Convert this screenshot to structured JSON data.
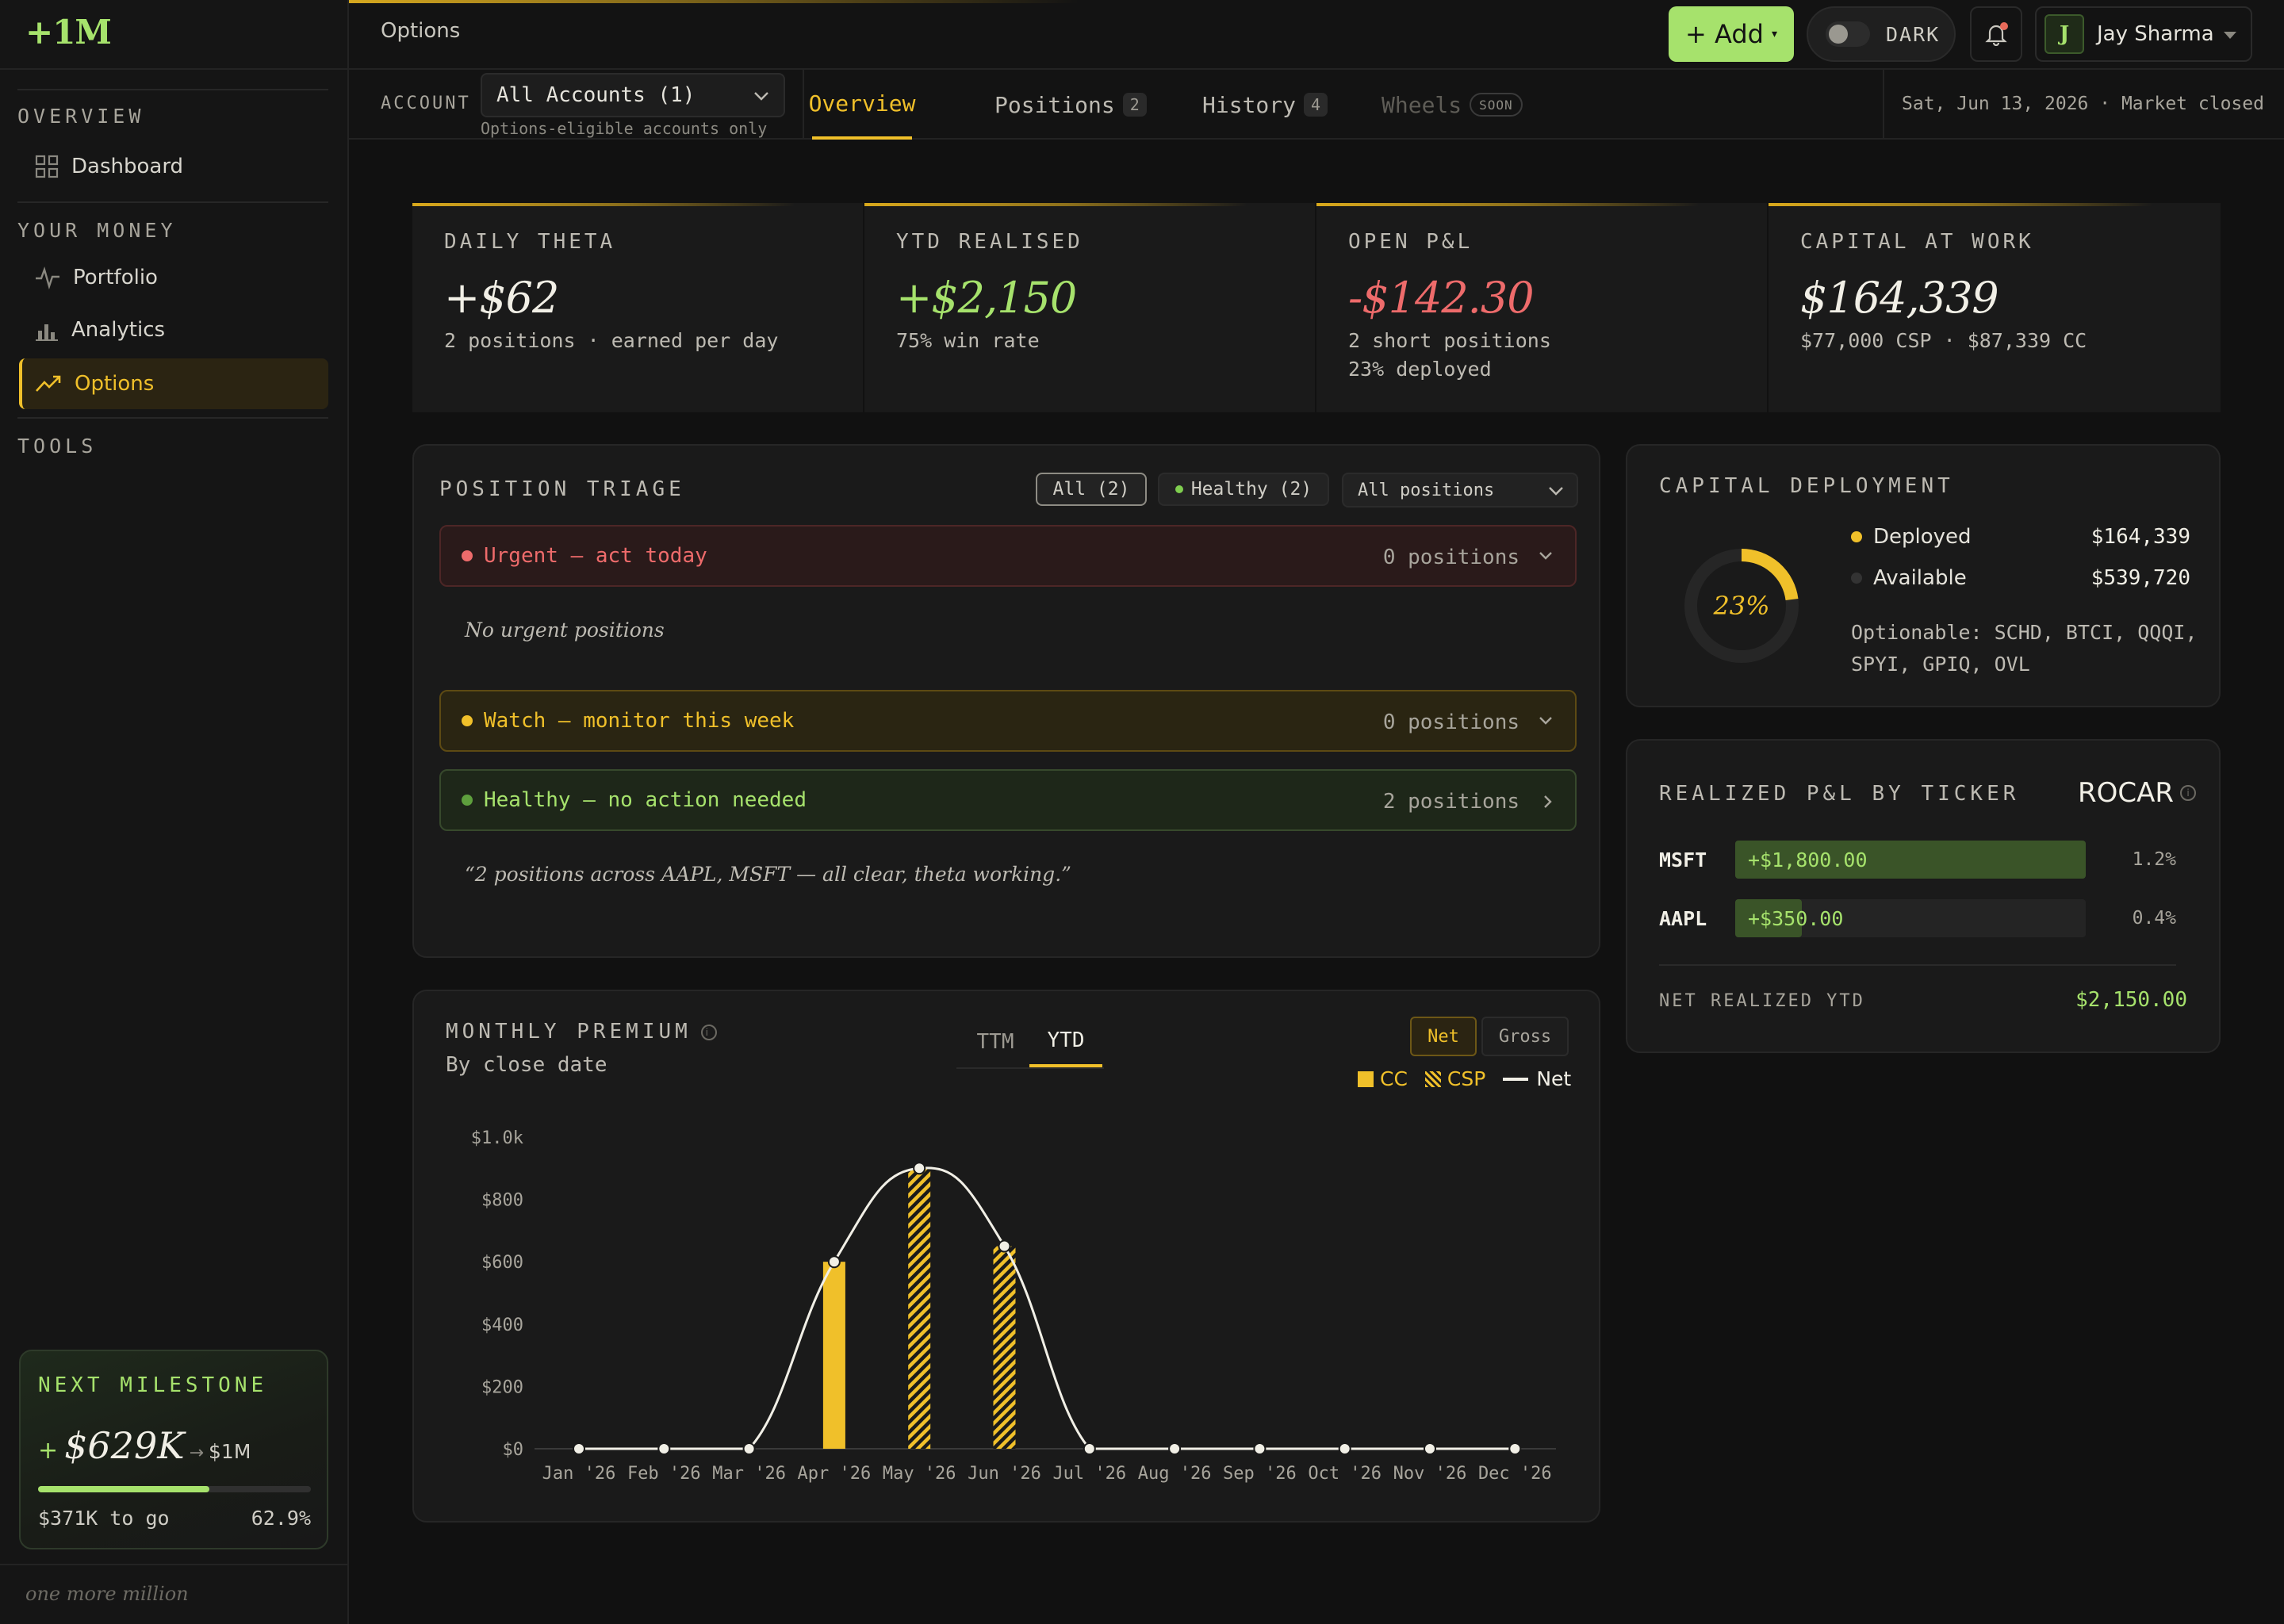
{
  "app": {
    "logo": "+1M",
    "tagline": "one more million"
  },
  "sidebar": {
    "sections": [
      {
        "label": "OVERVIEW",
        "items": [
          {
            "label": "Dashboard",
            "icon": "grid-icon"
          }
        ]
      },
      {
        "label": "YOUR MONEY",
        "items": [
          {
            "label": "Portfolio",
            "icon": "pulse-icon"
          },
          {
            "label": "Analytics",
            "icon": "bar-chart-icon"
          },
          {
            "label": "Options",
            "icon": "trend-up-icon",
            "active": true
          }
        ]
      },
      {
        "label": "TOOLS",
        "items": []
      }
    ],
    "milestone": {
      "title": "NEXT MILESTONE",
      "plus": "+",
      "amount": "$629K",
      "arrow": "→",
      "goal": "$1M",
      "progress": 0.629,
      "to_go": "$371K to go",
      "percent": "62.9%"
    }
  },
  "header": {
    "title": "Options",
    "add_label": "+ Add",
    "dark_label": "DARK",
    "user_initial": "J",
    "user_name": "Jay Sharma"
  },
  "tabbar": {
    "account_label": "ACCOUNT",
    "account_value": "All Accounts (1)",
    "account_note": "Options-eligible accounts only",
    "tabs": [
      {
        "label": "Overview",
        "active": true
      },
      {
        "label": "Positions",
        "badge": "2"
      },
      {
        "label": "History",
        "badge": "4"
      },
      {
        "label": "Wheels",
        "soon": "SOON",
        "disabled": true
      }
    ],
    "date_text": "Sat, Jun 13, 2026 · Market closed"
  },
  "kpis": [
    {
      "label": "DAILY THETA",
      "value": "+$62",
      "color": "#f1efe6",
      "sub": [
        "2 positions · earned per day"
      ]
    },
    {
      "label": "YTD REALISED",
      "value": "+$2,150",
      "color": "#a6e26c",
      "sub": [
        "75% win rate"
      ]
    },
    {
      "label": "OPEN P&L",
      "value": "-$142.30",
      "color": "#ee6b6b",
      "sub": [
        "2 short positions",
        "23% deployed"
      ]
    },
    {
      "label": "CAPITAL AT WORK",
      "value": "$164,339",
      "color": "#f1efe6",
      "sub": [
        "$77,000 CSP · $87,339 CC"
      ]
    }
  ],
  "triage": {
    "title": "POSITION TRIAGE",
    "filter_all": "All (2)",
    "filter_healthy": "Healthy (2)",
    "select_value": "All positions",
    "urgent": {
      "label": "Urgent — act today",
      "count": "0 positions"
    },
    "empty_note": "No urgent positions",
    "watch": {
      "label": "Watch — monitor this week",
      "count": "0 positions"
    },
    "healthy": {
      "label": "Healthy — no action needed",
      "count": "2 positions"
    },
    "quote": "“2 positions across AAPL, MSFT — all clear, theta working.”"
  },
  "premium": {
    "title": "MONTHLY PREMIUM",
    "subtitle": "By close date",
    "tabs": [
      "TTM",
      "YTD"
    ],
    "active_tab": "YTD",
    "net_label": "Net",
    "gross_label": "Gross",
    "legend": {
      "cc": "CC",
      "csp": "CSP",
      "net": "Net"
    }
  },
  "chart_data": {
    "type": "bar",
    "title": "MONTHLY PREMIUM",
    "categories": [
      "Jan '26",
      "Feb '26",
      "Mar '26",
      "Apr '26",
      "May '26",
      "Jun '26",
      "Jul '26",
      "Aug '26",
      "Sep '26",
      "Oct '26",
      "Nov '26",
      "Dec '26"
    ],
    "series": [
      {
        "name": "CC",
        "kind": "bar-solid",
        "values": [
          0,
          0,
          0,
          600,
          0,
          0,
          0,
          0,
          0,
          0,
          0,
          0
        ]
      },
      {
        "name": "CSP",
        "kind": "bar-hatched",
        "values": [
          0,
          0,
          0,
          0,
          900,
          650,
          0,
          0,
          0,
          0,
          0,
          0
        ]
      },
      {
        "name": "Net",
        "kind": "line",
        "values": [
          0,
          0,
          0,
          600,
          900,
          650,
          0,
          0,
          0,
          0,
          0,
          0
        ]
      }
    ],
    "yticks": [
      "$0",
      "$200",
      "$400",
      "$600",
      "$800",
      "$1.0k"
    ],
    "ylim": [
      0,
      1000
    ],
    "grid": false,
    "legend_position": "top-right",
    "colors": {
      "bar": "#f0c02a",
      "line": "#f1efe6"
    }
  },
  "deployment": {
    "title": "CAPITAL DEPLOYMENT",
    "percent_label": "23%",
    "fraction": 0.23,
    "deployed": {
      "label": "Deployed",
      "value": "$164,339"
    },
    "available": {
      "label": "Available",
      "value": "$539,720"
    },
    "optionable": "Optionable: SCHD, BTCI, QQQI, SPYI, GPIQ, OVL"
  },
  "realized": {
    "title": "REALIZED P&L BY TICKER",
    "badge": "ROCAR",
    "rows": [
      {
        "ticker": "MSFT",
        "value": "+$1,800.00",
        "pct": "1.2%",
        "fraction": 1.0
      },
      {
        "ticker": "AAPL",
        "value": "+$350.00",
        "pct": "0.4%",
        "fraction": 0.19
      }
    ],
    "foot_label": "NET REALIZED YTD",
    "foot_value": "$2,150.00"
  }
}
